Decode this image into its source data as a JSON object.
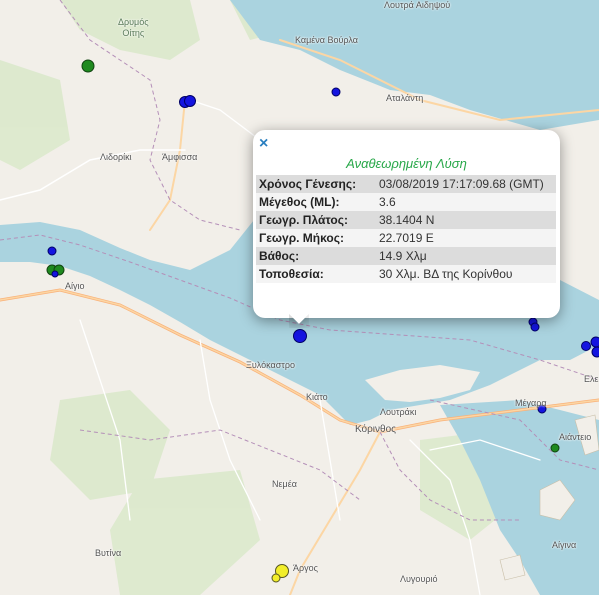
{
  "map": {
    "places": [
      {
        "id": "loutra-aidipsou",
        "name": "Λουτρά Αιδηψού"
      },
      {
        "id": "drymos-oitis",
        "name": "Δρυμός\nΟίτης"
      },
      {
        "id": "kamena-vourla",
        "name": "Καμένα Βούρλα"
      },
      {
        "id": "atalanti",
        "name": "Αταλάντη"
      },
      {
        "id": "lidoriki",
        "name": "Λιδορίκι"
      },
      {
        "id": "amfissa",
        "name": "Άμφισσα"
      },
      {
        "id": "aigio",
        "name": "Αίγιο"
      },
      {
        "id": "xylokastro",
        "name": "Ξυλόκαστρο"
      },
      {
        "id": "kiato",
        "name": "Κιάτο"
      },
      {
        "id": "loutraki",
        "name": "Λουτράκι"
      },
      {
        "id": "korinthos",
        "name": "Κόρινθος"
      },
      {
        "id": "megara",
        "name": "Μέγαρα"
      },
      {
        "id": "aiantio",
        "name": "Αιάντειο"
      },
      {
        "id": "elefsina",
        "name": "Ελε"
      },
      {
        "id": "nemea",
        "name": "Νεμέα"
      },
      {
        "id": "vytina",
        "name": "Βυτίνα"
      },
      {
        "id": "argos",
        "name": "Άργος"
      },
      {
        "id": "aigina",
        "name": "Αίγινα"
      },
      {
        "id": "lygourio",
        "name": "Λυγουριό"
      }
    ],
    "marker_colors": {
      "blue": "#1414e0",
      "green": "#1f8a1f",
      "yellow": "#f2ee2a"
    }
  },
  "popup": {
    "close_label": "×",
    "title": "Αναθεωρημένη Λύση",
    "rows": [
      {
        "key": "Χρόνος Γένεσης:",
        "value": "03/08/2019 17:17:09.68 (GMT)"
      },
      {
        "key": "Μέγεθος (ML):",
        "value": "3.6"
      },
      {
        "key": "Γεωγρ. Πλάτος:",
        "value": "38.1404 N"
      },
      {
        "key": "Γεωγρ. Μήκος:",
        "value": "22.7019 E"
      },
      {
        "key": "Βάθος:",
        "value": "14.9 Χλμ"
      },
      {
        "key": "Τοποθεσία:",
        "value": "30 Χλμ. ΒΔ της Κορίνθου"
      }
    ]
  }
}
